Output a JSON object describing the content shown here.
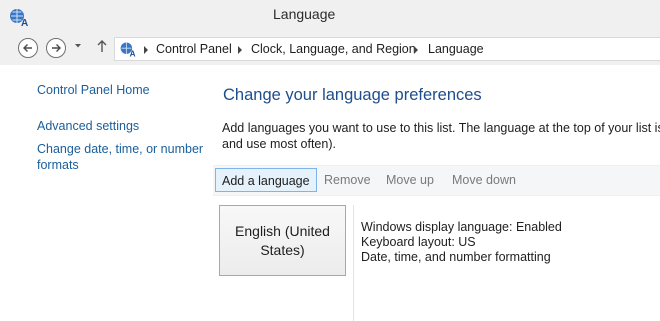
{
  "window": {
    "title": "Language"
  },
  "address": {
    "crumbs": [
      "Control Panel",
      "Clock, Language, and Region",
      "Language"
    ]
  },
  "sidebar": {
    "links": [
      "Control Panel Home",
      "Advanced settings",
      "Change date, time, or number formats"
    ]
  },
  "main": {
    "heading": "Change your language preferences",
    "description": "Add languages you want to use to this list. The language at the top of your list is yo and use most often).",
    "toolbar": {
      "add": "Add a language",
      "remove": "Remove",
      "move_up": "Move up",
      "move_down": "Move down"
    },
    "language": {
      "name": "English (United States)",
      "details": [
        "Windows display language: Enabled",
        "Keyboard layout: US",
        "Date, time, and number formatting"
      ]
    }
  },
  "icons": [
    "language-globe-icon",
    "back-icon",
    "forward-icon",
    "dropdown-icon",
    "up-arrow-icon",
    "breadcrumb-separator-icon"
  ],
  "colors": {
    "link": "#1a5e9a",
    "heading": "#1e4e8c",
    "active_button_bg": "#e5f1fb",
    "active_button_border": "#7eb4ea"
  }
}
